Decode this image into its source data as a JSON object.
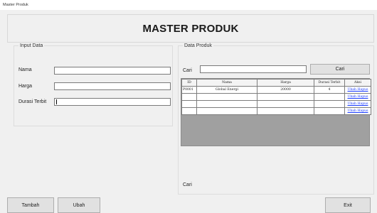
{
  "window": {
    "title": "Master Produk"
  },
  "header": {
    "title": "MASTER PRODUK"
  },
  "input_group": {
    "caption": "Input Data",
    "fields": [
      {
        "label": "Nama",
        "value": ""
      },
      {
        "label": "Harga",
        "value": ""
      },
      {
        "label": "Durasi Terbit",
        "value": ""
      }
    ]
  },
  "data_group": {
    "caption": "Data Produk",
    "search_label": "Cari",
    "search_value": "",
    "search_button": "Cari",
    "bottom_label": "Cari",
    "table": {
      "columns": [
        "ID",
        "Nama",
        "Harga",
        "Durasi Terbit",
        "Aksi"
      ],
      "rows": [
        [
          "P0001",
          "Global Energi",
          "20000",
          "4",
          "Ubah Hapus"
        ],
        [
          "",
          "",
          "",
          "",
          "Ubah Hapus"
        ],
        [
          "",
          "",
          "",
          "",
          "Ubah Hapus"
        ],
        [
          "",
          "",
          "",
          "",
          "Ubah Hapus"
        ]
      ]
    }
  },
  "buttons": {
    "tambah": "Tambah",
    "ubah": "Ubah",
    "exit": "Exit"
  },
  "colors": {
    "link": "#1a3cff",
    "form_bg": "#f0f0f0",
    "grid_empty": "#a0a0a0"
  }
}
